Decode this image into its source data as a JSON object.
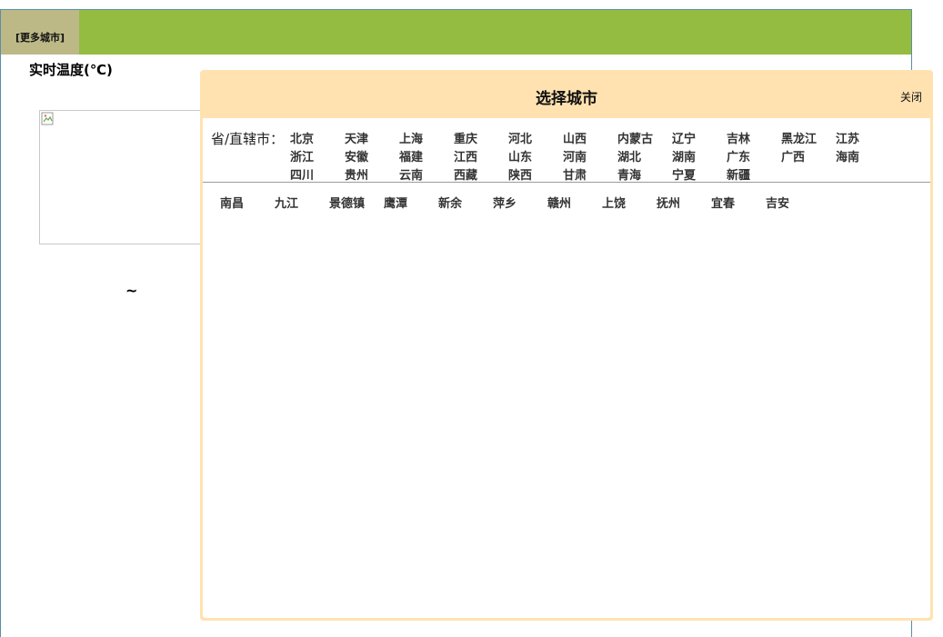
{
  "page": {
    "more_city_label": "[更多城市]",
    "realtime_temp_label": "实时温度(℃)",
    "tilde": "~"
  },
  "dialog": {
    "title": "选择城市",
    "close_label": "关闭",
    "province_label": "省/直辖市：",
    "provinces": [
      "北京",
      "天津",
      "上海",
      "重庆",
      "河北",
      "山西",
      "内蒙古",
      "辽宁",
      "吉林",
      "黑龙江",
      "江苏",
      "浙江",
      "安徽",
      "福建",
      "江西",
      "山东",
      "河南",
      "湖北",
      "湖南",
      "广东",
      "广西",
      "海南",
      "四川",
      "贵州",
      "云南",
      "西藏",
      "陕西",
      "甘肃",
      "青海",
      "宁夏",
      "新疆"
    ],
    "cities": [
      "南昌",
      "九江",
      "景德镇",
      "鹰潭",
      "新余",
      "萍乡",
      "赣州",
      "上饶",
      "抚州",
      "宜春",
      "吉安"
    ]
  },
  "colors": {
    "topbar": "#94bc40",
    "more_city_bg": "#bdb987",
    "dialog_bg": "#ffe2b0"
  }
}
